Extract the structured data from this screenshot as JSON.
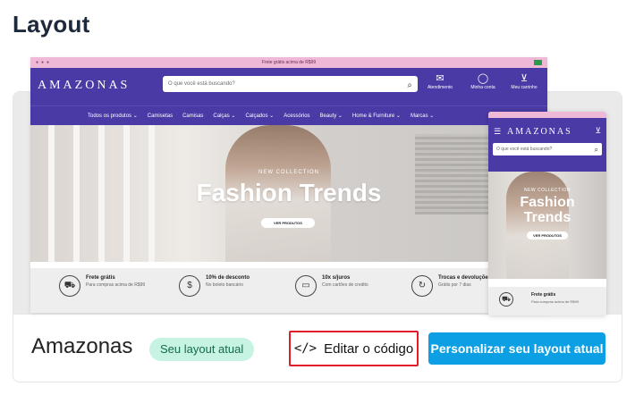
{
  "page": {
    "title": "Layout"
  },
  "preview": {
    "desktop": {
      "promo_text": "Frete grátis acima de R$99",
      "logo": "AMAZONAS",
      "search_placeholder": "O que você está buscando?",
      "header_icons": [
        {
          "label": "Atendimento",
          "icon": "chat-icon"
        },
        {
          "label": "Minha conta",
          "icon": "user-icon"
        },
        {
          "label": "Meu carrinho",
          "icon": "cart-icon"
        }
      ],
      "nav": [
        "Todos os produtos ⌄",
        "Camisetas",
        "Camisas",
        "Calças ⌄",
        "Calçados ⌄",
        "Acessórios",
        "Beauty ⌄",
        "Home & Furniture ⌄",
        "Marcas ⌄"
      ],
      "hero": {
        "kicker": "NEW COLLECTION",
        "headline": "Fashion Trends",
        "cta": "VER PRODUTOS"
      },
      "features": [
        {
          "title": "Frete grátis",
          "subtitle": "Para compras acima de R$99",
          "icon": "truck-icon"
        },
        {
          "title": "10% de desconto",
          "subtitle": "No boleto bancário",
          "icon": "dollar-icon"
        },
        {
          "title": "10x s/juros",
          "subtitle": "Com cartões de credito",
          "icon": "card-icon"
        },
        {
          "title": "Trocas e devoluções",
          "subtitle": "Grátis por 7 dias",
          "icon": "refresh-icon"
        }
      ]
    },
    "mobile": {
      "logo": "AMAZONAS",
      "search_placeholder": "O que você está buscando?",
      "hero": {
        "kicker": "NEW COLLECTION",
        "headline_line1": "Fashion",
        "headline_line2": "Trends",
        "cta": "VER PRODUTOS"
      },
      "feature": {
        "title": "Frete grátis",
        "subtitle": "Para compras acima de R$99",
        "icon": "truck-icon"
      }
    }
  },
  "layout_card": {
    "name": "Amazonas",
    "badge": "Seu layout atual",
    "edit_code_label": "Editar o código",
    "edit_code_icon": "code-icon",
    "customize_label": "Personalizar seu layout atual"
  },
  "colors": {
    "brand": "#4a3aa5",
    "primary_button": "#0d9fe4",
    "badge_bg": "#c6f3e2",
    "highlight_border": "#e11d2a"
  }
}
